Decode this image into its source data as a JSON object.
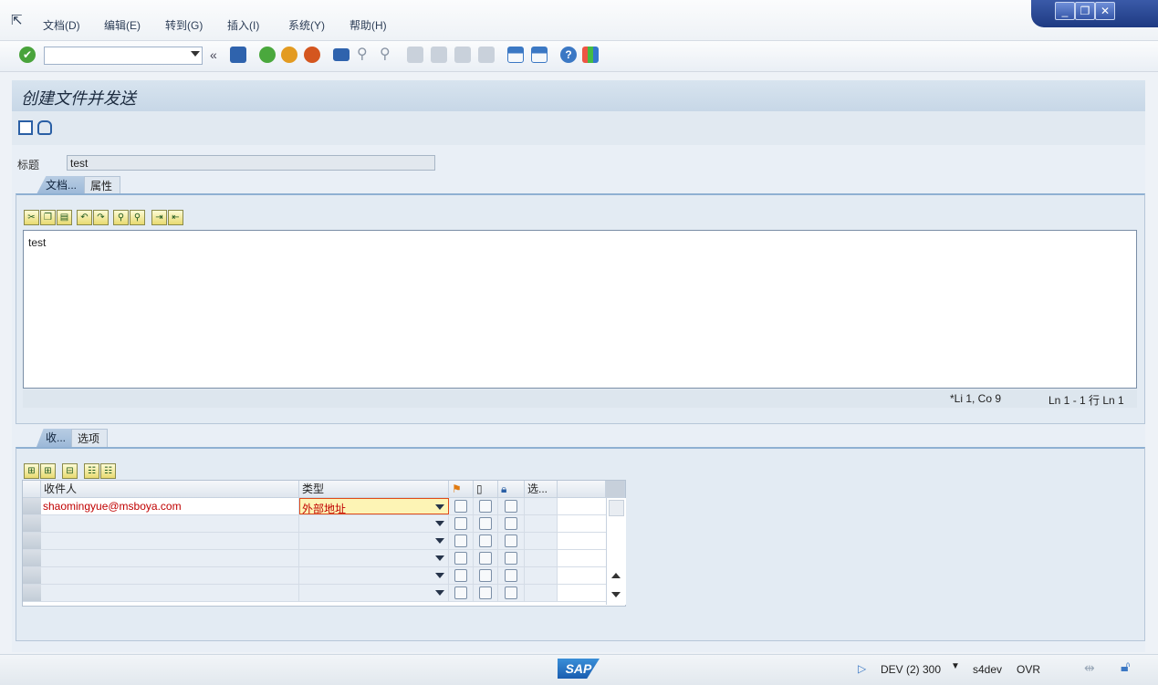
{
  "menu": {
    "items": [
      "文档(D)",
      "编辑(E)",
      "转到(G)",
      "插入(I)",
      "系统(Y)",
      "帮助(H)"
    ]
  },
  "window_controls": [
    "minimize-icon",
    "restore-icon",
    "close-icon"
  ],
  "toolbar": {
    "command_field_value": "",
    "icons": [
      "enter-icon",
      "save-icon",
      "back-icon",
      "exit-icon",
      "cancel-icon",
      "print-icon",
      "find-icon",
      "find-next-icon",
      "first-page-icon",
      "previous-page-icon",
      "next-page-icon",
      "last-page-icon",
      "create-session-icon",
      "shortcut-icon",
      "help-icon",
      "customize-layout-icon"
    ]
  },
  "title": "创建文件并发送",
  "app_toolbar": {
    "icons": [
      "send-icon",
      "attach-icon"
    ]
  },
  "form": {
    "title_label": "标题",
    "title_value": "test"
  },
  "doc_tabs": [
    {
      "label": "文档...",
      "active": true
    },
    {
      "label": "属性",
      "active": false
    }
  ],
  "editor": {
    "toolbar_icons": [
      "cut-icon",
      "copy-icon",
      "paste-icon",
      "undo-icon",
      "redo-icon",
      "find-icon",
      "find-next-icon",
      "import-icon",
      "export-icon"
    ],
    "content": "test",
    "cursor_status": "*Li 1, Co 9",
    "line_status": "Ln 1 - 1 行 Ln 1"
  },
  "recipient_tabs": [
    {
      "label": "收...",
      "active": true
    },
    {
      "label": "选项",
      "active": false
    }
  ],
  "recipients": {
    "toolbar_icons": [
      "insert-row-icon",
      "append-row-icon",
      "delete-row-icon",
      "distribution-list-icon",
      "address-book-icon"
    ],
    "columns": {
      "recipient": "收件人",
      "type": "类型",
      "express_icon": "express-icon",
      "copy_icon": "copy-icon",
      "blind_icon": "blind-copy-icon",
      "options": "选..."
    },
    "rows": [
      {
        "recipient": "shaomingyue@msboya.com",
        "type": "外部地址"
      },
      {
        "recipient": "",
        "type": ""
      },
      {
        "recipient": "",
        "type": ""
      },
      {
        "recipient": "",
        "type": ""
      },
      {
        "recipient": "",
        "type": ""
      },
      {
        "recipient": "",
        "type": ""
      }
    ]
  },
  "statusbar": {
    "logo": "SAP",
    "system": "DEV (2) 300",
    "server": "s4dev",
    "mode": "OVR"
  },
  "colors": {
    "accent": "#3a6bb0",
    "error_text": "#c00000",
    "type_cell_bg": "#fdf4b5"
  }
}
